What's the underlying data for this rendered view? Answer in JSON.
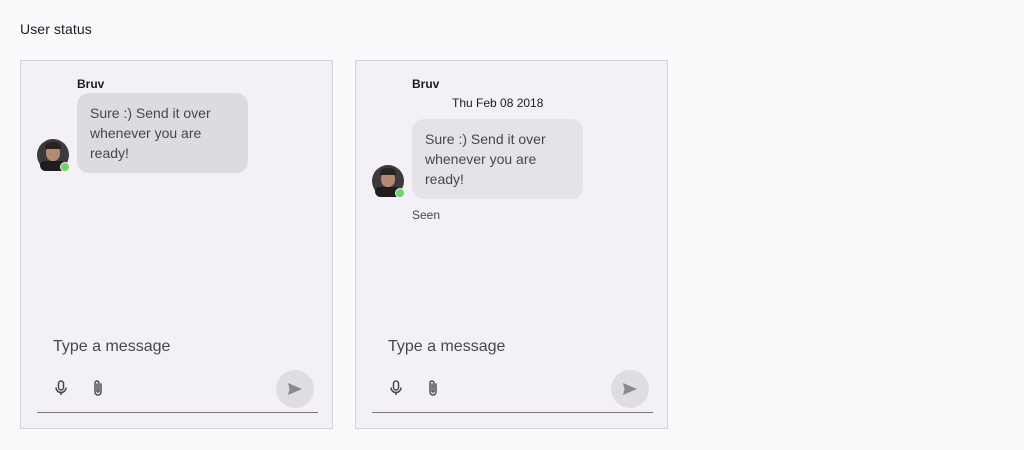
{
  "section": {
    "title": "User status"
  },
  "panels": [
    {
      "sender": "Bruv",
      "message": "Sure :) Send it over whenever you are ready!",
      "input_placeholder": "Type a message"
    },
    {
      "sender": "Bruv",
      "date": "Thu Feb 08 2018",
      "message": "Sure :) Send it over whenever you are ready!",
      "seen_label": "Seen",
      "input_placeholder": "Type a message"
    }
  ],
  "colors": {
    "online_status": "#6fd26a",
    "bubble": "#e3dfe6",
    "panel_bg": "#f3f0f6"
  },
  "icons": [
    "microphone-icon",
    "paperclip-icon",
    "send-icon"
  ]
}
